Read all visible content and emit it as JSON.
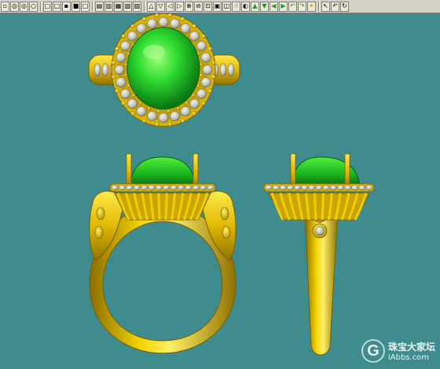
{
  "toolbar": {
    "buttons": [
      {
        "name": "view-point-icon",
        "glyph": "▫"
      },
      {
        "name": "view-circle-icon",
        "glyph": "◎"
      },
      {
        "name": "view-circle2-icon",
        "glyph": "◎"
      },
      {
        "name": "view-circle3-icon",
        "glyph": "○"
      },
      {
        "name": "sep"
      },
      {
        "name": "view-box1-icon",
        "glyph": "□"
      },
      {
        "name": "view-box2-icon",
        "glyph": "□"
      },
      {
        "name": "view-box3-icon",
        "glyph": "▪"
      },
      {
        "name": "view-box4-icon",
        "glyph": "■"
      },
      {
        "name": "view-box5-icon",
        "glyph": "□"
      },
      {
        "name": "sep"
      },
      {
        "name": "view-split1-icon",
        "glyph": "▤"
      },
      {
        "name": "view-split2-icon",
        "glyph": "▥"
      },
      {
        "name": "view-split3-icon",
        "glyph": "▦"
      },
      {
        "name": "view-split4-icon",
        "glyph": "▧"
      },
      {
        "name": "view-split5-icon",
        "glyph": "▨"
      },
      {
        "name": "sep"
      },
      {
        "name": "triangle-up-icon",
        "glyph": "△"
      },
      {
        "name": "triangle-down-icon",
        "glyph": "▽"
      },
      {
        "name": "arrow-left-icon",
        "glyph": "◁"
      },
      {
        "name": "arrow-right-icon",
        "glyph": "▷"
      },
      {
        "name": "zoom-in-icon",
        "glyph": "⊕"
      },
      {
        "name": "zoom-out-icon",
        "glyph": "⊖"
      },
      {
        "name": "zoom-window-icon",
        "glyph": "⊡"
      },
      {
        "name": "zoom-extents-icon",
        "glyph": "▣"
      },
      {
        "name": "zoom-fit-icon",
        "glyph": "◫"
      },
      {
        "name": "pan-icon",
        "glyph": "☝"
      },
      {
        "name": "shade-icon",
        "glyph": "◐"
      },
      {
        "name": "green-up-icon",
        "glyph": "▲",
        "cls": "green"
      },
      {
        "name": "green-down-icon",
        "glyph": "▼",
        "cls": "green"
      },
      {
        "name": "green-left-icon",
        "glyph": "◀",
        "cls": "green"
      },
      {
        "name": "green-right-icon",
        "glyph": "▶",
        "cls": "green"
      },
      {
        "name": "rotate-left-icon",
        "glyph": "↶",
        "cls": "green"
      },
      {
        "name": "rotate-right-icon",
        "glyph": "↷",
        "cls": "green"
      },
      {
        "name": "light-icon",
        "glyph": "✦",
        "cls": "yellow"
      },
      {
        "name": "sep"
      },
      {
        "name": "select-arrow-icon",
        "glyph": "↖"
      },
      {
        "name": "undo-icon",
        "glyph": "↶"
      },
      {
        "name": "redo-icon",
        "glyph": "↻"
      }
    ]
  },
  "colors": {
    "background": "#3f8c8f",
    "gold": "#e6c200",
    "gold_dark": "#9a7b00",
    "gold_light": "#fff066",
    "emerald": "#22cc22",
    "emerald_light": "#7dff5a",
    "diamond": "#c8c8b8"
  },
  "watermark": {
    "logo_letter": "G",
    "site_name_cn": "珠宝大家坛",
    "site_url": "iAbbs.com"
  }
}
